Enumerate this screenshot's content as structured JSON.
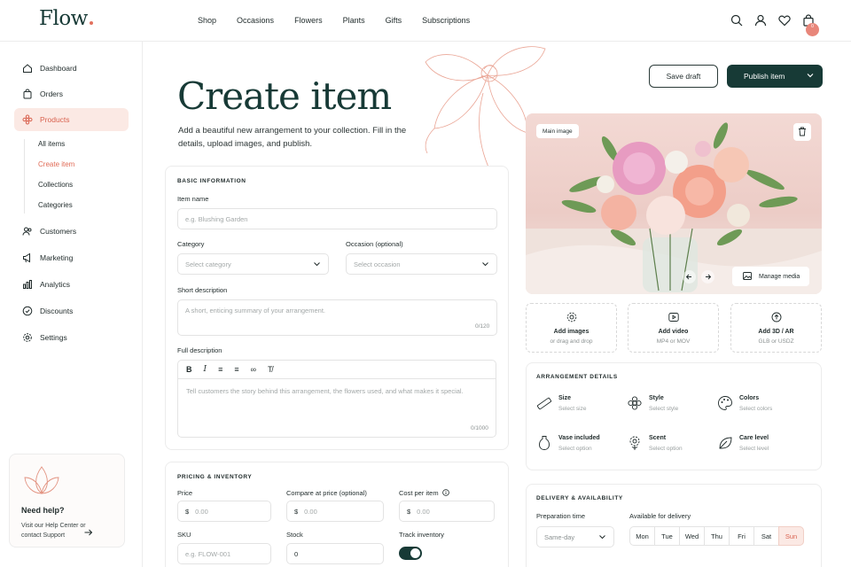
{
  "brand": {
    "logo": "Flow",
    "accent": "#e2715e",
    "primary": "#173a36"
  },
  "nav": {
    "items": [
      "Shop",
      "Occasions",
      "Flowers",
      "Plants",
      "Gifts",
      "Subscriptions"
    ],
    "cart_count": "0"
  },
  "sidebar": {
    "items": [
      "Dashboard",
      "Orders",
      "Products",
      "Customers",
      "Marketing",
      "Analytics",
      "Discounts",
      "Settings"
    ],
    "active": "Products",
    "sub_items": [
      "All items",
      "Create item",
      "Collections",
      "Categories"
    ],
    "active_sub": "Create item",
    "help": {
      "title": "Need help?",
      "text": "Visit our Help Center or contact Support"
    }
  },
  "header": {
    "title": "Create item",
    "subtitle": "Add a beautiful new arrangement to your collection. Fill in the details, upload images, and publish.",
    "save_draft": "Save draft",
    "publish": "Publish item"
  },
  "basic": {
    "section": "BASIC INFORMATION",
    "item_name_label": "Item name",
    "item_name_placeholder": "e.g. Blushing Garden",
    "category_label": "Category",
    "category_placeholder": "Select category",
    "occasion_label": "Occasion (optional)",
    "occasion_placeholder": "Select occasion",
    "short_label": "Short description",
    "short_placeholder": "A short, enticing summary of your arrangement.",
    "short_counter": "0/120",
    "full_label": "Full description",
    "full_placeholder": "Tell customers the story behind this arrangement, the flowers used, and what makes it special.",
    "full_counter": "0/1000"
  },
  "pricing": {
    "section": "PRICING & INVENTORY",
    "price_label": "Price",
    "price_placeholder": "0.00",
    "compare_label": "Compare at price  (optional)",
    "compare_placeholder": "0.00",
    "cost_label": "Cost per item",
    "cost_placeholder": "0.00",
    "currency": "$",
    "sku_label": "SKU",
    "sku_placeholder": "e.g. FLOW-001",
    "stock_label": "Stock",
    "stock_value": "0",
    "track_label": "Track inventory",
    "track_on": true
  },
  "media": {
    "main_tag": "Main image",
    "manage": "Manage media",
    "uploads": [
      {
        "title": "Add images",
        "sub": "or drag and drop"
      },
      {
        "title": "Add video",
        "sub": "MP4 or MOV"
      },
      {
        "title": "Add 3D / AR",
        "sub": "GLB or USDZ"
      }
    ]
  },
  "arrangement": {
    "section": "ARRANGEMENT DETAILS",
    "items": [
      {
        "title": "Size",
        "sub": "Select size"
      },
      {
        "title": "Style",
        "sub": "Select style"
      },
      {
        "title": "Colors",
        "sub": "Select colors"
      },
      {
        "title": "Vase included",
        "sub": "Select option"
      },
      {
        "title": "Scent",
        "sub": "Select option"
      },
      {
        "title": "Care level",
        "sub": "Select level"
      }
    ]
  },
  "delivery": {
    "section": "DELIVERY & AVAILABILITY",
    "prep_label": "Preparation time",
    "prep_value": "Same-day",
    "avail_label": "Available for delivery",
    "days": [
      "Mon",
      "Tue",
      "Wed",
      "Thu",
      "Fri",
      "Sat",
      "Sun"
    ],
    "selected_day": "Sun"
  }
}
